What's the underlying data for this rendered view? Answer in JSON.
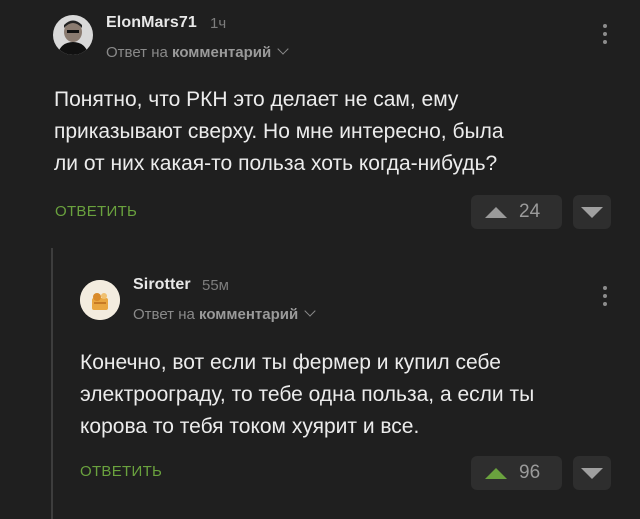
{
  "comments": [
    {
      "username": "ElonMars71",
      "time": "1ч",
      "reply_prefix": "Ответ на",
      "reply_target": "комментарий",
      "text": "Понятно, что РКН это делает не сам, ему\nприказывают сверху. Но мне интересно, была\nли от них какая-то польза хоть когда-нибудь?",
      "reply_label": "ОТВЕТИТЬ",
      "votes": "24"
    },
    {
      "username": "Sirotter",
      "time": "55м",
      "reply_prefix": "Ответ на",
      "reply_target": "комментарий",
      "text": "Конечно, вот если ты фермер и купил себе\nэлектроограду, то тебе одна польза, а если ты\nкорова то тебя током хуярит и все.",
      "reply_label": "ОТВЕТИТЬ",
      "votes": "96"
    }
  ],
  "colors": {
    "background": "#1f1f1f",
    "accent_green": "#6aa23e",
    "button_bg": "#2e2e2e"
  },
  "icons": [
    "avatar",
    "chevron-down-icon",
    "more-vertical-icon",
    "upvote-icon",
    "downvote-icon"
  ]
}
